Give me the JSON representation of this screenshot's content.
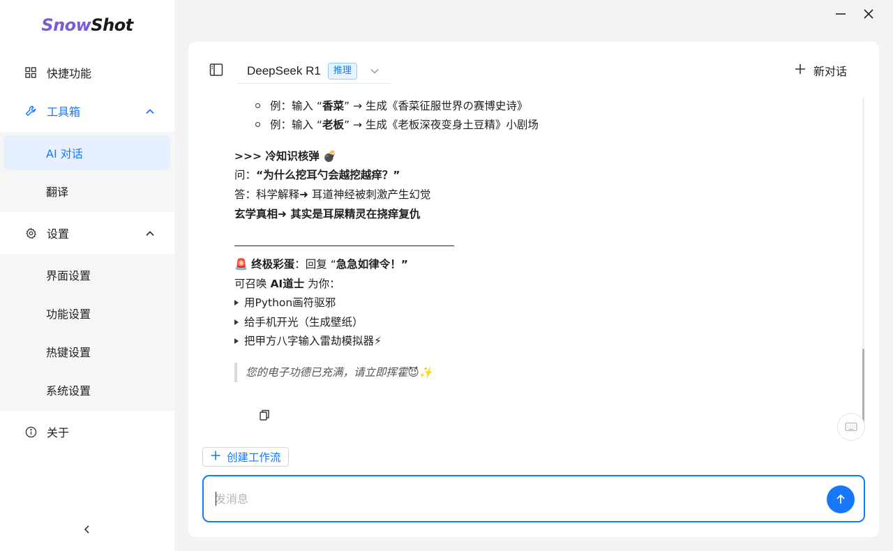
{
  "app": {
    "logo_part1": "Snow",
    "logo_part2": "Shot"
  },
  "sidebar": {
    "quick": "快捷功能",
    "toolbox": "工具箱",
    "toolbox_items": [
      "AI 对话",
      "翻译"
    ],
    "settings": "设置",
    "settings_items": [
      "界面设置",
      "功能设置",
      "热键设置",
      "系统设置"
    ],
    "about": "关于"
  },
  "header": {
    "model_name": "DeepSeek R1",
    "model_badge": "推理",
    "new_chat": "新对话"
  },
  "message": {
    "ex1_a": "例：输入 “",
    "ex1_b": "香菜",
    "ex1_c": "” → 生成《香菜征服世界の赛博史诗》",
    "ex2_a": "例：输入 “",
    "ex2_b": "老板",
    "ex2_c": "” → 生成《老板深夜变身土豆精》小剧场",
    "trivia_title": ">>> 冷知识核弹 💣",
    "q_a": "问：",
    "q_b": "“为什么挖耳勺会越挖越痒？”",
    "answer": "答：科学解释➜ 耳道神经被刺激产生幻觉",
    "truth": "玄学真相➜ 其实是耳屎精灵在挠痒复仇",
    "egg_icon": "🚨",
    "egg_b": "终极彩蛋",
    "egg_a": "：回复 “",
    "egg_c": "急急如律令！”",
    "summon_a": "可召唤 ",
    "summon_b": "AI道士",
    "summon_c": " 为你：",
    "items": [
      "用Python画符驱邪",
      "给手机开光（生成壁纸）",
      "把甲方八字输入雷劫模拟器⚡"
    ],
    "quote": "您的电子功德已充满，请立即挥霍😈✨"
  },
  "footer": {
    "workflow": "创建工作流",
    "input_placeholder": "发消息",
    "input_value": ""
  },
  "colors": {
    "accent": "#1677ff",
    "logo_accent": "#7b5bd6"
  }
}
